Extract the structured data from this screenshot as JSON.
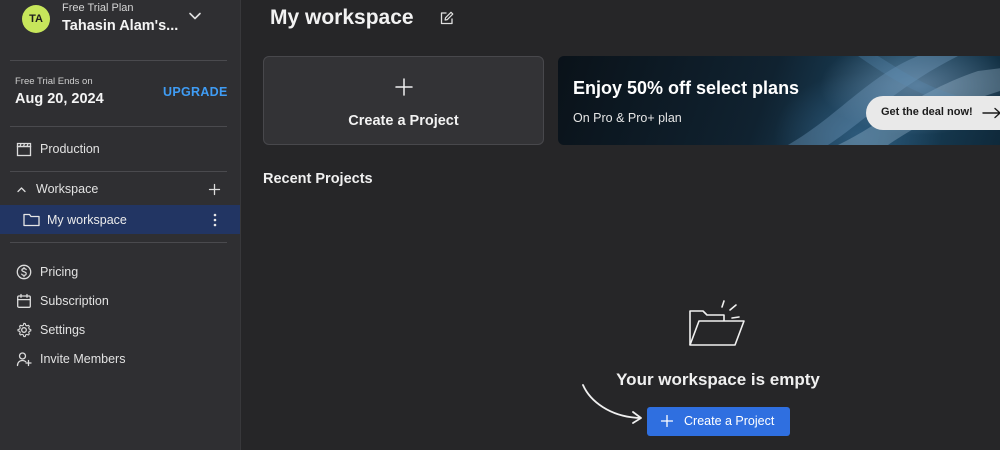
{
  "account": {
    "initials": "TA",
    "plan": "Free Trial Plan",
    "name": "Tahasin Alam's..."
  },
  "trial": {
    "label": "Free Trial Ends on",
    "date": "Aug 20, 2024",
    "upgrade_label": "UPGRADE"
  },
  "sidebar": {
    "production": "Production",
    "workspace_header": "Workspace",
    "workspace_item": "My workspace",
    "items": [
      {
        "label": "Pricing",
        "icon": "dollar-circle-icon"
      },
      {
        "label": "Subscription",
        "icon": "calendar-icon"
      },
      {
        "label": "Settings",
        "icon": "gear-icon"
      },
      {
        "label": "Invite Members",
        "icon": "user-plus-icon"
      }
    ]
  },
  "main": {
    "title": "My workspace",
    "create_card_label": "Create a Project",
    "promo": {
      "title": "Enjoy 50% off select plans",
      "subtitle": "On Pro & Pro+ plan",
      "button": "Get the deal now!"
    },
    "recent_title": "Recent Projects",
    "empty_title": "Your workspace is empty",
    "cta_label": "Create a Project"
  },
  "colors": {
    "accent": "#2f6fe0",
    "upgrade": "#3f9cf4",
    "avatar": "#c7e65b",
    "selected_row": "#223563"
  }
}
